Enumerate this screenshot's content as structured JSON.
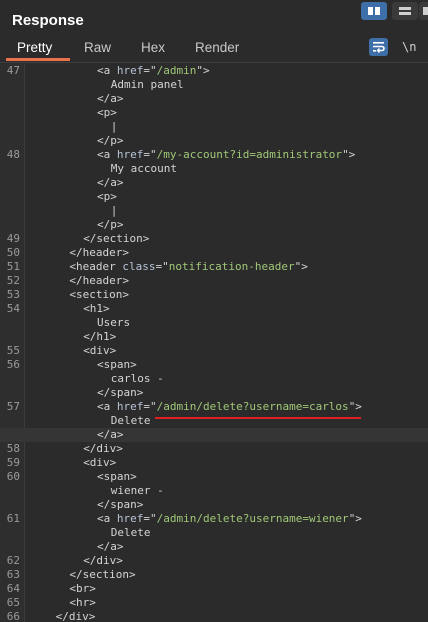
{
  "panel": {
    "title": "Response"
  },
  "tabs": [
    "Pretty",
    "Raw",
    "Hex",
    "Render"
  ],
  "toolbar": {
    "newline_label": "\\n"
  },
  "code_lines": [
    {
      "n": "47",
      "segs": [
        [
          "t",
          "<a "
        ],
        [
          "a",
          "href"
        ],
        [
          "t",
          "=\""
        ],
        [
          "s",
          "/admin"
        ],
        [
          "t",
          "\">"
        ]
      ]
    },
    {
      "n": "",
      "segs": [
        [
          "t",
          "Admin panel"
        ]
      ]
    },
    {
      "n": "",
      "segs": [
        [
          "t",
          "</a>"
        ]
      ]
    },
    {
      "n": "",
      "segs": [
        [
          "t",
          "<p>"
        ]
      ]
    },
    {
      "n": "",
      "segs": [
        [
          "t",
          "|"
        ]
      ]
    },
    {
      "n": "",
      "segs": [
        [
          "t",
          "</p>"
        ]
      ]
    },
    {
      "n": "48",
      "segs": [
        [
          "t",
          "<a "
        ],
        [
          "a",
          "href"
        ],
        [
          "t",
          "=\""
        ],
        [
          "s",
          "/my-account?id=administrator"
        ],
        [
          "t",
          "\">"
        ]
      ]
    },
    {
      "n": "",
      "segs": [
        [
          "t",
          "My account"
        ]
      ]
    },
    {
      "n": "",
      "segs": [
        [
          "t",
          "</a>"
        ]
      ]
    },
    {
      "n": "",
      "segs": [
        [
          "t",
          "<p>"
        ]
      ]
    },
    {
      "n": "",
      "segs": [
        [
          "t",
          "|"
        ]
      ]
    },
    {
      "n": "",
      "segs": [
        [
          "t",
          "</p>"
        ]
      ]
    },
    {
      "n": "49",
      "segs": [
        [
          "t",
          "</section>"
        ]
      ]
    },
    {
      "n": "50",
      "segs": [
        [
          "t",
          "</header>"
        ]
      ]
    },
    {
      "n": "51",
      "segs": [
        [
          "t",
          "<header "
        ],
        [
          "a",
          "class"
        ],
        [
          "t",
          "=\""
        ],
        [
          "s",
          "notification-header"
        ],
        [
          "t",
          "\">"
        ]
      ]
    },
    {
      "n": "52",
      "segs": [
        [
          "t",
          "</header>"
        ]
      ]
    },
    {
      "n": "53",
      "segs": [
        [
          "t",
          "<section>"
        ]
      ]
    },
    {
      "n": "54",
      "segs": [
        [
          "t",
          "<h1>"
        ]
      ]
    },
    {
      "n": "",
      "segs": [
        [
          "t",
          "Users"
        ]
      ]
    },
    {
      "n": "",
      "segs": [
        [
          "t",
          "</h1>"
        ]
      ]
    },
    {
      "n": "55",
      "segs": [
        [
          "t",
          "<div>"
        ]
      ]
    },
    {
      "n": "56",
      "segs": [
        [
          "t",
          "<span>"
        ]
      ]
    },
    {
      "n": "",
      "segs": [
        [
          "t",
          "carlos -"
        ]
      ]
    },
    {
      "n": "",
      "segs": [
        [
          "t",
          "</span>"
        ]
      ]
    },
    {
      "n": "57",
      "segs": [
        [
          "t",
          "<a "
        ],
        [
          "a",
          "href"
        ],
        [
          "t",
          "=\""
        ],
        [
          "s",
          "/admin/delete?username=carlos"
        ],
        [
          "t",
          "\">"
        ]
      ]
    },
    {
      "n": "",
      "segs": [
        [
          "t",
          "Delete"
        ]
      ]
    },
    {
      "n": "",
      "segs": [
        [
          "t",
          "</a>"
        ]
      ]
    },
    {
      "n": "58",
      "segs": [
        [
          "t",
          "</div>"
        ]
      ]
    },
    {
      "n": "59",
      "segs": [
        [
          "t",
          "<div>"
        ]
      ]
    },
    {
      "n": "60",
      "segs": [
        [
          "t",
          "<span>"
        ]
      ]
    },
    {
      "n": "",
      "segs": [
        [
          "t",
          "wiener -"
        ]
      ]
    },
    {
      "n": "",
      "segs": [
        [
          "t",
          "</span>"
        ]
      ]
    },
    {
      "n": "61",
      "segs": [
        [
          "t",
          "<a "
        ],
        [
          "a",
          "href"
        ],
        [
          "t",
          "=\""
        ],
        [
          "s",
          "/admin/delete?username=wiener"
        ],
        [
          "t",
          "\">"
        ]
      ]
    },
    {
      "n": "",
      "segs": [
        [
          "t",
          "Delete"
        ]
      ]
    },
    {
      "n": "",
      "segs": [
        [
          "t",
          "</a>"
        ]
      ]
    },
    {
      "n": "62",
      "segs": [
        [
          "t",
          "</div>"
        ]
      ]
    },
    {
      "n": "63",
      "segs": [
        [
          "t",
          "</section>"
        ]
      ]
    },
    {
      "n": "64",
      "segs": [
        [
          "t",
          "<br>"
        ]
      ]
    },
    {
      "n": "65",
      "segs": [
        [
          "t",
          "<hr>"
        ]
      ]
    },
    {
      "n": "66",
      "segs": [
        [
          "t",
          "</div>"
        ]
      ]
    }
  ]
}
